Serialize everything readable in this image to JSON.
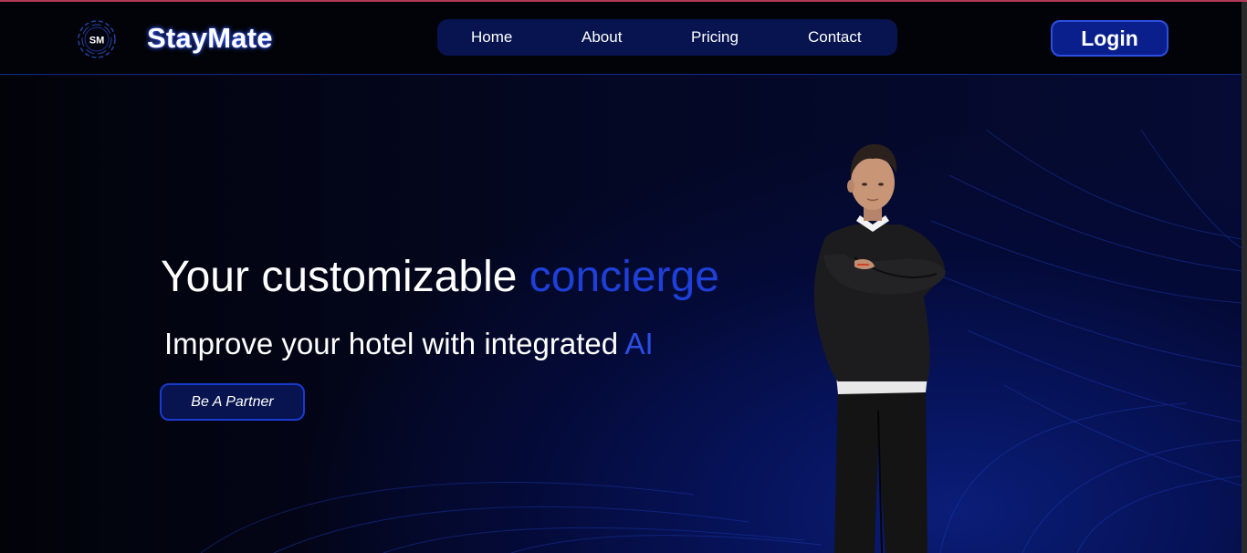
{
  "app": {
    "brand_name": "StayMate",
    "logo_initials": "SM"
  },
  "nav": {
    "items": [
      {
        "label": "Home"
      },
      {
        "label": "About"
      },
      {
        "label": "Pricing"
      },
      {
        "label": "Contact"
      }
    ],
    "login_label": "Login"
  },
  "hero": {
    "headline_main": "Your customizable ",
    "headline_accent": "concierge",
    "subheadline_main": "Improve your hotel with integrated ",
    "subheadline_accent": "AI",
    "cta_label": "Be A Partner"
  },
  "icons": {
    "logo": "sm-logo-icon",
    "avatar": "concierge-avatar"
  },
  "colors": {
    "background": "#03050f",
    "accent_blue": "#1e40d8",
    "nav_bg": "#07144f",
    "login_bg": "#0a1f8c",
    "border_blue": "#2d4fe0"
  }
}
